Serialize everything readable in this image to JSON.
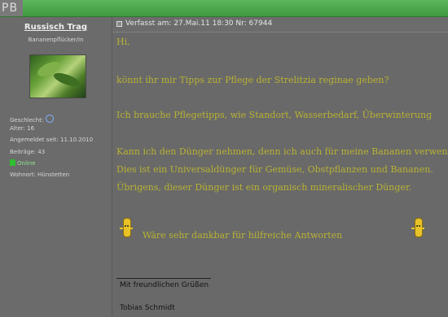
{
  "app": {
    "brand": "PB"
  },
  "profile": {
    "username": "Russisch Trag",
    "rank": "Bananenpflücker/in",
    "gender_label": "Geschlecht:",
    "age": "Alter: 16",
    "registered": "Angemeldet seit: 11.10.2010",
    "posts": "Beiträge: 43",
    "status": "Online",
    "location": "Wohnort: Hünstetten"
  },
  "post": {
    "meta": "Verfasst am: 27.Mai.11 18:30 Nr: 67944",
    "lines": [
      "Hi,",
      "könnt ihr mir Tipps zur Pflege der Strelitzia reginae geben?",
      "Ich brauche Pflegetipps, wie Standort, Wasserbedarf, Überwinterung",
      "Kann ich den Dünger nehmen, denn ich auch für meine Bananen verwende?",
      "Dies ist ein Universaldünger für Gemüse, Obstpflanzen und Bananen.",
      "Übrigens, dieser Dünger ist ein organisch mineralischer Dünger."
    ],
    "thanks": "Wäre sehr dankbar für hilfreiche Antworten",
    "signature": {
      "greeting": "Mit freundlichen Grüßen",
      "name": "Tobias Schmidt"
    }
  },
  "icons": {
    "post": "post-icon",
    "gender": "male-icon",
    "online": "online-icon",
    "smiley": "banana-smiley-icon"
  },
  "colors": {
    "topbar": "#4caf50",
    "text_yellow": "#b8b232",
    "background": "#696969"
  }
}
